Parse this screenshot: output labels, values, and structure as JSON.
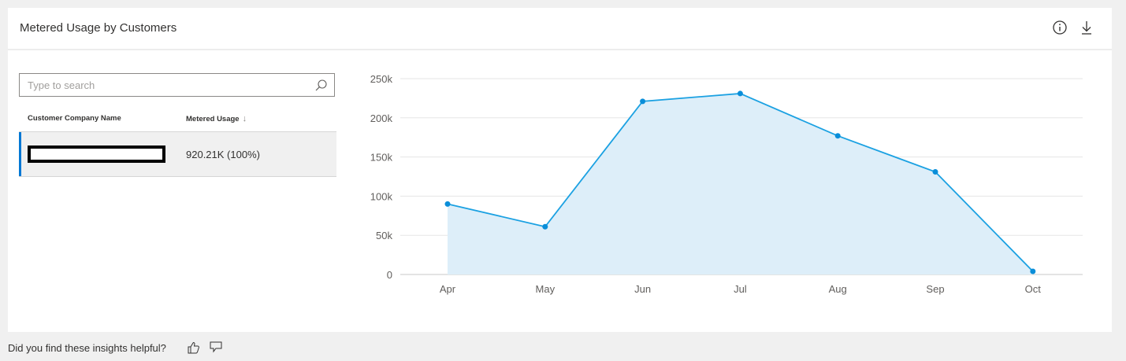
{
  "card": {
    "title": "Metered Usage by Customers",
    "icons": [
      "info-icon",
      "download-icon"
    ]
  },
  "search": {
    "placeholder": "Type to search",
    "value": ""
  },
  "table": {
    "columns": [
      "Customer Company Name",
      "Metered Usage"
    ],
    "sort_icon": "arrow-down-icon",
    "rows": [
      {
        "name": "",
        "value": "920.21K (100%)"
      }
    ]
  },
  "chart_data": {
    "type": "area",
    "categories": [
      "Apr",
      "May",
      "Jun",
      "Jul",
      "Aug",
      "Sep",
      "Oct"
    ],
    "values": [
      90000,
      61000,
      221000,
      231000,
      177000,
      131000,
      4000
    ],
    "y_ticks": [
      "0",
      "50k",
      "100k",
      "150k",
      "200k",
      "250k"
    ],
    "ylim": [
      0,
      250000
    ],
    "grid": true,
    "colors": {
      "line": "#1ba1e2",
      "fill": "#ddeef9",
      "grid": "#e6e6e6",
      "point": "#0a8ed9"
    }
  },
  "feedback": {
    "text": "Did you find these insights helpful?",
    "icons": [
      "thumbs-up-icon",
      "thumbs-down-icon"
    ]
  }
}
